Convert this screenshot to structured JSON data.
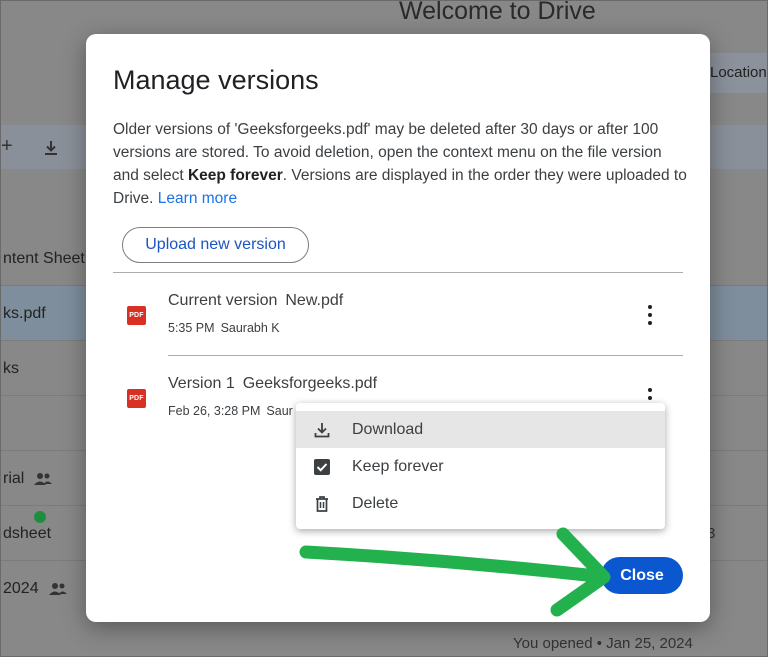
{
  "background": {
    "title": "Welcome to Drive",
    "location_header": "Location",
    "rows": [
      "ntent Sheet",
      "ks.pdf",
      "ks",
      "",
      "rial",
      "dsheet",
      "2024"
    ],
    "footer_text": "You opened • Jan 25, 2024",
    "side_char": "3"
  },
  "dialog": {
    "title": "Manage versions",
    "desc_part1": "Older versions of 'Geeksforgeeks.pdf' may be deleted after 30 days or after 100 versions are stored. To avoid deletion, open the context menu on the file version and select ",
    "desc_bold": "Keep forever",
    "desc_part2": ". Versions are displayed in the order they were uploaded to Drive. ",
    "learn_more": "Learn more",
    "upload_button": "Upload new version",
    "close_button": "Close",
    "pdf_icon_label": "PDF",
    "versions": [
      {
        "label": "Current version",
        "filename": "New.pdf",
        "time": "5:35 PM",
        "author": "Saurabh K"
      },
      {
        "label": "Version 1",
        "filename": "Geeksforgeeks.pdf",
        "time": "Feb 26, 3:28 PM",
        "author": "Saur"
      }
    ]
  },
  "context_menu": {
    "items": [
      {
        "label": "Download",
        "icon": "download-icon"
      },
      {
        "label": "Keep forever",
        "icon": "checkbox-checked-icon"
      },
      {
        "label": "Delete",
        "icon": "trash-icon"
      }
    ]
  },
  "colors": {
    "primary": "#0b57d0",
    "link": "#1a73e8",
    "pdf_red": "#d93025",
    "annotation_green": "#22b14c"
  }
}
